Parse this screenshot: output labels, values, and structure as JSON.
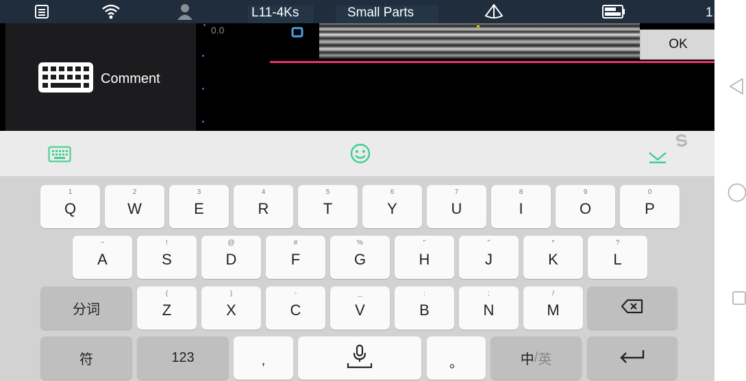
{
  "status_bar": {
    "probe": "L11-4Ks",
    "preset": "Small Parts",
    "right_text": "1",
    "icons": [
      "list-icon",
      "wifi-icon",
      "user-icon",
      "probe-icon",
      "battery-icon"
    ]
  },
  "left_panel": {
    "comment_label": "Comment",
    "icon": "keyboard-icon"
  },
  "image_area": {
    "depth_label": "0.0",
    "accent_color": "#e8356b"
  },
  "dialog": {
    "ok_label": "OK"
  },
  "ime_toolbar": {
    "icons": [
      "keyboard-switch-icon",
      "emoji-icon",
      "collapse-keyboard-icon"
    ],
    "accent_color": "#3ccf8e"
  },
  "keyboard": {
    "row1": [
      {
        "hint": "1",
        "label": "Q"
      },
      {
        "hint": "2",
        "label": "W"
      },
      {
        "hint": "3",
        "label": "E"
      },
      {
        "hint": "4",
        "label": "R"
      },
      {
        "hint": "5",
        "label": "T"
      },
      {
        "hint": "6",
        "label": "Y"
      },
      {
        "hint": "7",
        "label": "U"
      },
      {
        "hint": "8",
        "label": "I"
      },
      {
        "hint": "9",
        "label": "O"
      },
      {
        "hint": "0",
        "label": "P"
      }
    ],
    "row2": [
      {
        "hint": "~",
        "label": "A"
      },
      {
        "hint": "!",
        "label": "S"
      },
      {
        "hint": "@",
        "label": "D"
      },
      {
        "hint": "#",
        "label": "F"
      },
      {
        "hint": "%",
        "label": "G"
      },
      {
        "hint": "\"",
        "label": "H"
      },
      {
        "hint": "\"",
        "label": "J"
      },
      {
        "hint": "*",
        "label": "K"
      },
      {
        "hint": "?",
        "label": "L"
      }
    ],
    "row3": {
      "left_label": "分词",
      "keys": [
        {
          "hint": "(",
          "label": "Z"
        },
        {
          "hint": ")",
          "label": "X"
        },
        {
          "hint": "-",
          "label": "C"
        },
        {
          "hint": "_",
          "label": "V"
        },
        {
          "hint": ":",
          "label": "B"
        },
        {
          "hint": ";",
          "label": "N"
        },
        {
          "hint": "/",
          "label": "M"
        }
      ],
      "backspace_icon": "backspace-icon"
    },
    "row4": {
      "symbol_label": "符",
      "numbers_label": "123",
      "comma_label": ",",
      "space_icon": "microphone-icon",
      "period_label": "。",
      "lang_zh": "中",
      "lang_sep": "/",
      "lang_en": "英",
      "enter_icon": "enter-icon"
    }
  },
  "nav_bar": {
    "icons": [
      "back-icon",
      "home-icon",
      "recents-icon"
    ]
  }
}
